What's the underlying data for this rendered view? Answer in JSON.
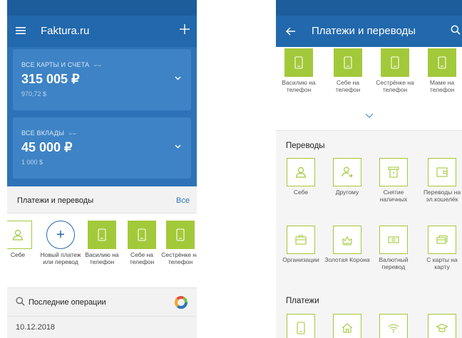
{
  "left": {
    "app_title": "Faktura.ru",
    "cards": [
      {
        "label": "ВСЕ КАРТЫ И СЧЕТА",
        "amount": "315 005 ₽",
        "sub": "970,72 $"
      },
      {
        "label": "ВСЕ ВКЛАДЫ",
        "amount": "45 000 ₽",
        "sub": "1 000 $"
      }
    ],
    "payments_title": "Платежи и переводы",
    "payments_all": "Все",
    "payments": [
      {
        "label": "Себе",
        "kind": "self"
      },
      {
        "label": "Новый платеж или перевод",
        "kind": "new"
      },
      {
        "label": "Василию на телефон",
        "kind": "phone"
      },
      {
        "label": "Себе на телефон",
        "kind": "phone"
      },
      {
        "label": "Сестрёнке на телефон",
        "kind": "phone"
      }
    ],
    "ops_title": "Последние операции",
    "date": "10.12.2018"
  },
  "right": {
    "app_title": "Платежи и переводы",
    "quick": [
      {
        "label": "Василию на телефон"
      },
      {
        "label": "Себе на телефон"
      },
      {
        "label": "Сестрёнке на телефон"
      },
      {
        "label": "Маме на телефон"
      }
    ],
    "transfers_title": "Переводы",
    "transfers": [
      {
        "label": "Себе",
        "icon": "person-icon"
      },
      {
        "label": "Другому",
        "icon": "person-arrow-icon"
      },
      {
        "label": "Снятие наличных",
        "icon": "atm-icon"
      },
      {
        "label": "Переводы на эл.кошелёк",
        "icon": "wallet-icon"
      },
      {
        "label": "Организации",
        "icon": "briefcase-icon"
      },
      {
        "label": "Золотая Корона",
        "icon": "crown-icon"
      },
      {
        "label": "Валютный перевод",
        "icon": "banknote-icon"
      },
      {
        "label": "С карты на карту",
        "icon": "card-icon"
      }
    ],
    "payments_title": "Платежи",
    "payments_icons": [
      "phone-icon",
      "home-icon",
      "wifi-icon",
      "graduation-cap-icon"
    ]
  },
  "colors": {
    "appbar": "#2268ad",
    "statusbar": "#1d5d9c",
    "accent_green": "#a2c93a",
    "card": "#3e83c5"
  }
}
